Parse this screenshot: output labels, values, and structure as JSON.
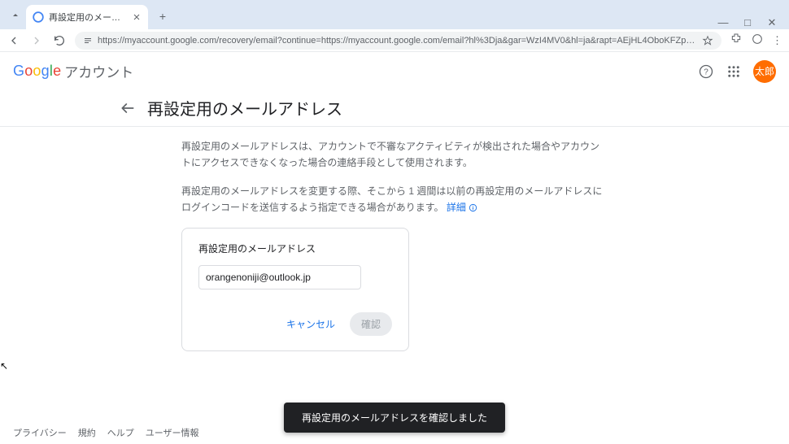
{
  "browser": {
    "tab_title": "再設定用のメールアドレス",
    "url": "https://myaccount.google.com/recovery/email?continue=https://myaccount.google.com/email?hl%3Dja&gar=WzI4MV0&hl=ja&rapt=AEjHL4OboKFZpWc20I5znbrUt_lthBPwuUqMZ2ak7vrxmuPCKOSOpC7354OvE-RVj_cbKyc7UmQ2kd4NLkn5P6p9jnnqjs5z..."
  },
  "header": {
    "app_name": "アカウント",
    "avatar_text": "太郎"
  },
  "page": {
    "title": "再設定用のメールアドレス",
    "desc1": "再設定用のメールアドレスは、アカウントで不審なアクティビティが検出された場合やアカウントにアクセスできなくなった場合の連絡手段として使用されます。",
    "desc2_prefix": "再設定用のメールアドレスを変更する際、そこから 1 週間は以前の再設定用のメールアドレスにログインコードを送信するよう指定できる場合があります。",
    "more_label": "詳細"
  },
  "card": {
    "label": "再設定用のメールアドレス",
    "email_value": "orangenoniji@outlook.jp",
    "cancel_label": "キャンセル",
    "confirm_label": "確認"
  },
  "toast": {
    "message": "再設定用のメールアドレスを確認しました"
  },
  "footer": {
    "privacy": "プライバシー",
    "terms": "規約",
    "help": "ヘルプ",
    "userinfo": "ユーザー情報"
  }
}
